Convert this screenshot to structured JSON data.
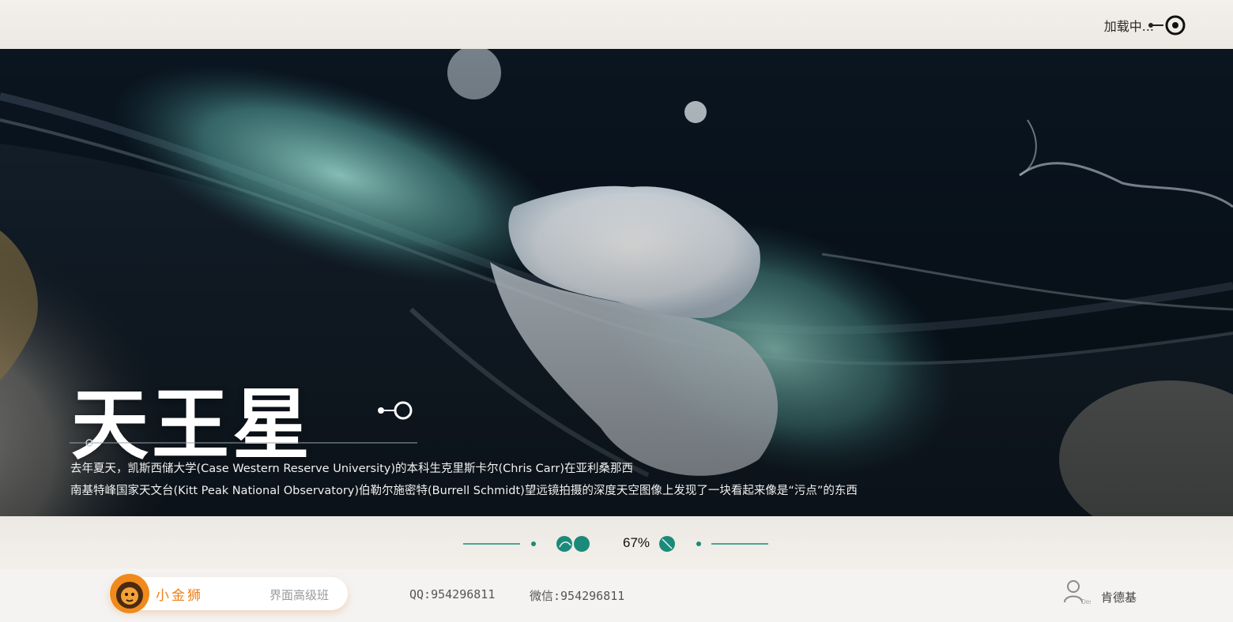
{
  "header": {
    "loading_text": "加载中..."
  },
  "hero": {
    "title": "天王星",
    "description_lines": [
      "去年夏天，凯斯西储大学(Case Western Reserve University)的本科生克里斯卡尔(Chris Carr)在亚利桑那西",
      "南基特峰国家天文台(Kitt Peak National Observatory)伯勒尔施密特(Burrell Schmidt)望远镜拍摄的深度天空图像上发现了一块看起来像是“污点”的东西"
    ]
  },
  "progress": {
    "percent_label": "67%",
    "value": 0.67,
    "accent_color": "#1a8a7a"
  },
  "footer": {
    "brand_name": "小金狮",
    "course_name": "界面高级班",
    "qq": "QQ:954296811",
    "wechat": "微信:954296811",
    "user_name": "肯德基",
    "user_icon_caption": "Des",
    "brand_color": "#f07f12"
  },
  "icons": [
    "loading-target-icon",
    "node-link-icon",
    "lion-logo-icon",
    "user-icon"
  ]
}
